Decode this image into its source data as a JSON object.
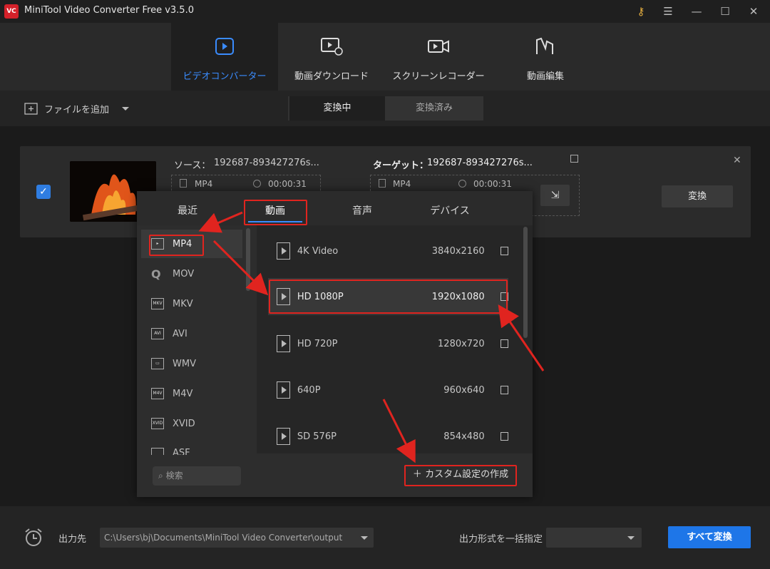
{
  "app": {
    "title": "MiniTool Video Converter Free v3.5.0",
    "logo": "VC"
  },
  "nav": {
    "tabs": [
      {
        "label": "ビデオコンバーター",
        "icon": "convert-icon"
      },
      {
        "label": "動画ダウンロード",
        "icon": "download-icon"
      },
      {
        "label": "スクリーンレコーダー",
        "icon": "camera-icon"
      },
      {
        "label": "動画編集",
        "icon": "edit-film-icon"
      }
    ]
  },
  "toolbar": {
    "add_file": "ファイルを追加",
    "seg_converting": "変換中",
    "seg_converted": "変換済み"
  },
  "file": {
    "source_label": "ソース：",
    "source_name": "192687-893427276s...",
    "source_format": "MP4",
    "source_duration": "00:00:31",
    "target_label": "ターゲット：",
    "target_name": "192687-893427276s...",
    "target_format": "MP4",
    "target_duration": "00:00:31",
    "convert": "変換",
    "checked": true
  },
  "popup": {
    "tabs": [
      "最近",
      "動画",
      "音声",
      "デバイス"
    ],
    "formats": [
      {
        "label": "MP4",
        "icon": "mp4-icon",
        "badge": ""
      },
      {
        "label": "MOV",
        "icon": "mov-icon",
        "badge": ""
      },
      {
        "label": "MKV",
        "icon": "mkv-icon",
        "badge": "MKV"
      },
      {
        "label": "AVI",
        "icon": "avi-icon",
        "badge": "AVI"
      },
      {
        "label": "WMV",
        "icon": "wmv-icon",
        "badge": ""
      },
      {
        "label": "M4V",
        "icon": "m4v-icon",
        "badge": "M4V"
      },
      {
        "label": "XVID",
        "icon": "xvid-icon",
        "badge": "XVID"
      },
      {
        "label": "ASF",
        "icon": "asf-icon",
        "badge": ""
      }
    ],
    "resolutions": [
      {
        "name": "4K Video",
        "size": "3840x2160"
      },
      {
        "name": "HD 1080P",
        "size": "1920x1080"
      },
      {
        "name": "HD 720P",
        "size": "1280x720"
      },
      {
        "name": "640P",
        "size": "960x640"
      },
      {
        "name": "SD 576P",
        "size": "854x480"
      }
    ],
    "custom": "カスタム設定の作成",
    "search_placeholder": "検索"
  },
  "bottom": {
    "output_label": "出力先",
    "output_path": "C:\\Users\\bj\\Documents\\MiniTool Video Converter\\output",
    "batch_label": "出力形式を一括指定",
    "convert_all": "すべて変換"
  },
  "colors": {
    "accent": "#1e76e8",
    "highlight": "#e0241f"
  }
}
